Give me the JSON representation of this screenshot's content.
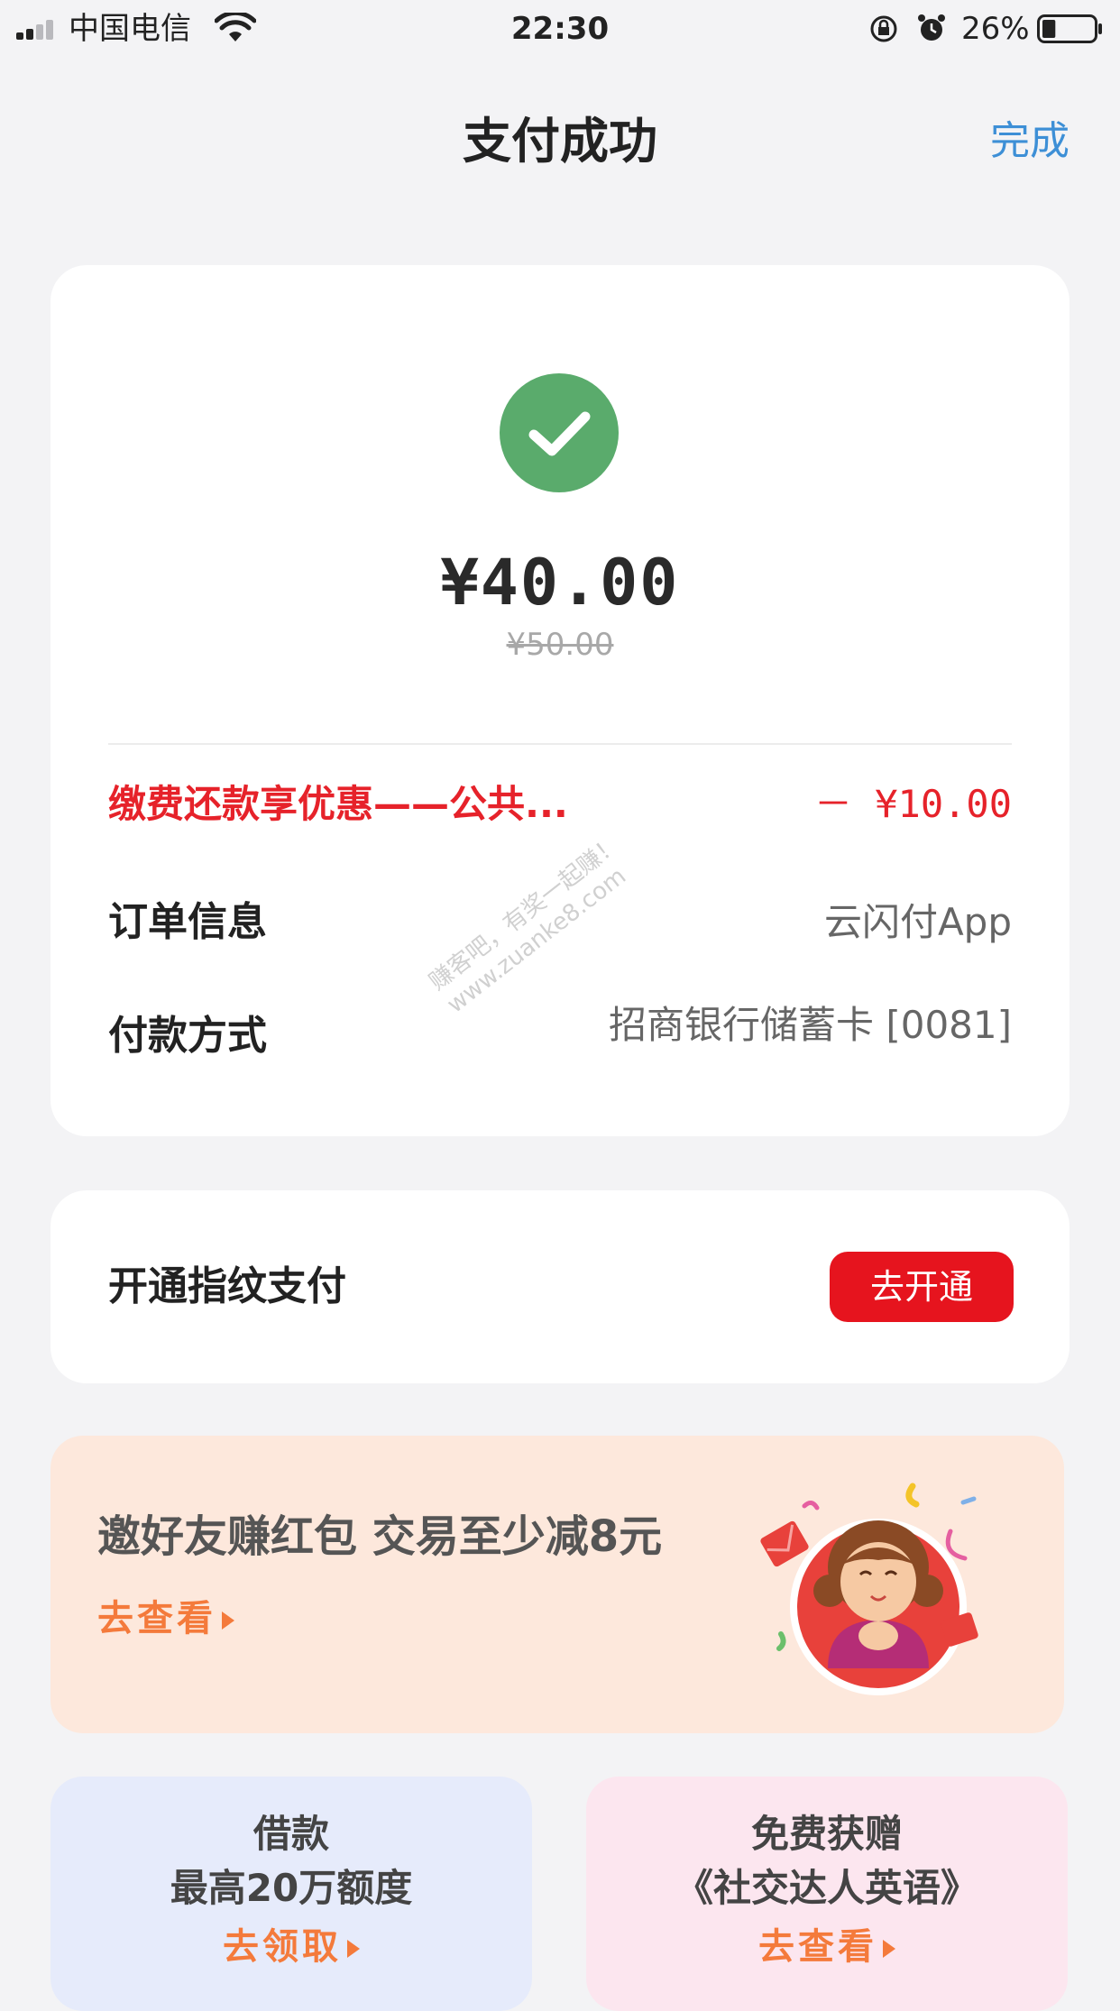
{
  "status_bar": {
    "carrier": "中国电信",
    "time": "22:30",
    "battery_percent": "26%",
    "battery_level": 0.26
  },
  "nav": {
    "title": "支付成功",
    "done": "完成"
  },
  "payment": {
    "amount": "¥40.00",
    "original_amount": "¥50.00",
    "discount_label": "缴费还款享优惠——公共...",
    "discount_value": "－ ¥10.00",
    "order_label": "订单信息",
    "order_value": "云闪付App",
    "method_label": "付款方式",
    "method_value": "招商银行储蓄卡 [0081]"
  },
  "watermark": {
    "line1": "赚客吧，有奖一起赚！",
    "line2": "www.zuanke8.com"
  },
  "fingerprint": {
    "label": "开通指纹支付",
    "button": "去开通"
  },
  "banner": {
    "title": "邀好友赚红包 交易至少减8元",
    "link": "去查看"
  },
  "tiles": [
    {
      "line1": "借款",
      "line2": "最高20万额度",
      "link": "去领取"
    },
    {
      "line1": "免费获赠",
      "line2": "《社交达人英语》",
      "link": "去查看"
    }
  ],
  "colors": {
    "accent_red": "#e6141e",
    "success_green": "#5aab6c",
    "link_blue": "#3d8fd6",
    "promo_orange": "#f47a3b"
  },
  "icons": [
    "signal-icon",
    "wifi-icon",
    "orientation-lock-icon",
    "alarm-icon",
    "battery-icon",
    "check-icon",
    "play-arrow-icon"
  ]
}
